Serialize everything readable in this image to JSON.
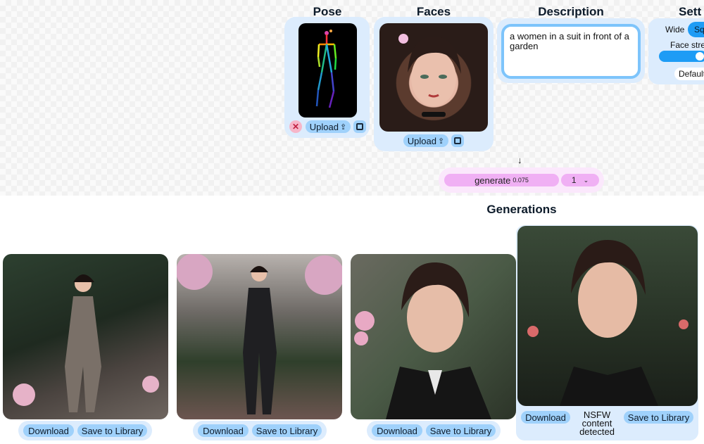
{
  "sections": {
    "pose": "Pose",
    "faces": "Faces",
    "description": "Description",
    "settings": "Sett",
    "generations": "Generations"
  },
  "pose_panel": {
    "upload_label": "Upload"
  },
  "faces_panel": {
    "upload_label": "Upload"
  },
  "description": {
    "text": "a women in a suit in front of a garden"
  },
  "settings": {
    "aspect_wide": "Wide",
    "aspect_square": "Sq",
    "face_strength_label": "Face stre",
    "default_label": "Default"
  },
  "generate": {
    "label": "generate",
    "cost": "0.075",
    "count": "1"
  },
  "arrow": "↓",
  "generations": [
    {
      "download": "Download",
      "save": "Save to Library"
    },
    {
      "download": "Download",
      "save": "Save to Library"
    },
    {
      "download": "Download",
      "save": "Save to Library"
    },
    {
      "download": "Download",
      "save": "Save to Library",
      "nsfw": "NSFW content detected"
    }
  ],
  "colors": {
    "panel": "#dcecfd",
    "pill": "#9fd1fb",
    "generate": "#f0b0f4",
    "title": "#0d1b2a",
    "accent": "#1e9cf5"
  }
}
